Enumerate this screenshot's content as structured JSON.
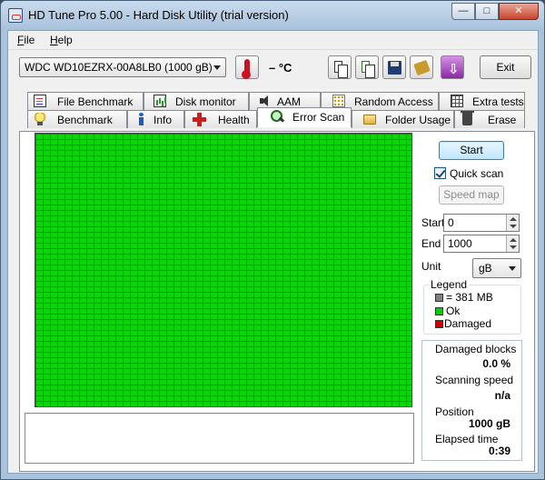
{
  "window": {
    "title": "HD Tune Pro 5.00 - Hard Disk Utility (trial version)"
  },
  "menu": [
    {
      "label": "File"
    },
    {
      "label": "Help"
    }
  ],
  "toolbar": {
    "drive": "WDC WD10EZRX-00A8LB0     (1000 gB)",
    "temperature": "– °C",
    "exit_label": "Exit"
  },
  "tabs_top": [
    {
      "label": "File Benchmark",
      "icon": "file-icon"
    },
    {
      "label": "Disk monitor",
      "icon": "chart-icon"
    },
    {
      "label": "AAM",
      "icon": "speaker-icon"
    },
    {
      "label": "Random Access",
      "icon": "dots-icon"
    },
    {
      "label": "Extra tests",
      "icon": "grid-icon"
    }
  ],
  "tabs_bottom": [
    {
      "label": "Benchmark",
      "icon": "bulb-icon"
    },
    {
      "label": "Info",
      "icon": "info-icon"
    },
    {
      "label": "Health",
      "icon": "health-cross-icon"
    },
    {
      "label": "Error Scan",
      "icon": "magnifier-icon",
      "active": true
    },
    {
      "label": "Folder Usage",
      "icon": "folder-icon"
    },
    {
      "label": "Erase",
      "icon": "trash-icon"
    }
  ],
  "scan": {
    "start_button": "Start",
    "quick_scan_label": "Quick scan",
    "quick_scan_checked": true,
    "speed_map_button": "Speed map",
    "start_label": "Start",
    "start_value": "0",
    "end_label": "End",
    "end_value": "1000",
    "unit_label": "Unit",
    "unit_value": "gB"
  },
  "legend": {
    "title": "Legend",
    "items": [
      {
        "label": "= 381 MB",
        "color": "#808080"
      },
      {
        "label": "Ok",
        "color": "#00d000"
      },
      {
        "label": "Damaged",
        "color": "#d00000"
      }
    ]
  },
  "stats": {
    "damaged_label": "Damaged blocks",
    "damaged_value": "0.0 %",
    "speed_label": "Scanning speed",
    "speed_value": "n/a",
    "position_label": "Position",
    "position_value": "1000 gB",
    "elapsed_label": "Elapsed time",
    "elapsed_value": "0:39"
  },
  "colors": {
    "ok_block": "#0bd40b",
    "titlebar": "#b8d0e8"
  }
}
